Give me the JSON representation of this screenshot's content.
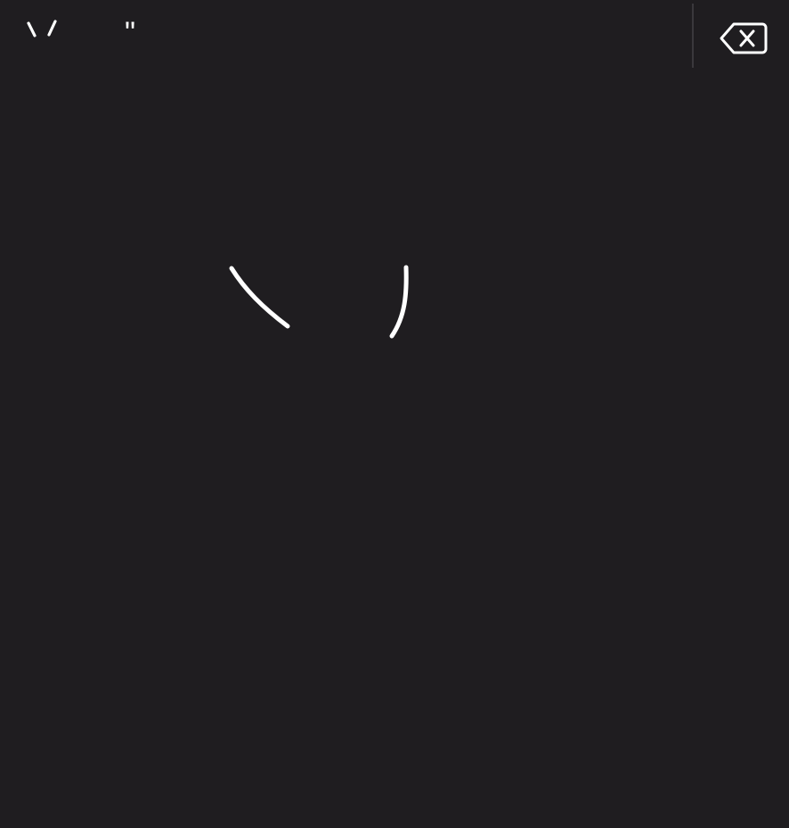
{
  "candidate_bar": {
    "candidates": [
      {
        "label": "ヽ/",
        "shape": "handwritten-strokes"
      },
      {
        "label": "\"",
        "shape": "double-quote"
      }
    ]
  },
  "delete_button": {
    "icon": "backspace-icon",
    "label": "Delete"
  },
  "writing_area": {
    "strokes_count": 2,
    "ink_color": "#ffffff"
  },
  "theme": {
    "background": "#1f1d20",
    "divider": "#3a383c",
    "foreground": "#ffffff"
  }
}
